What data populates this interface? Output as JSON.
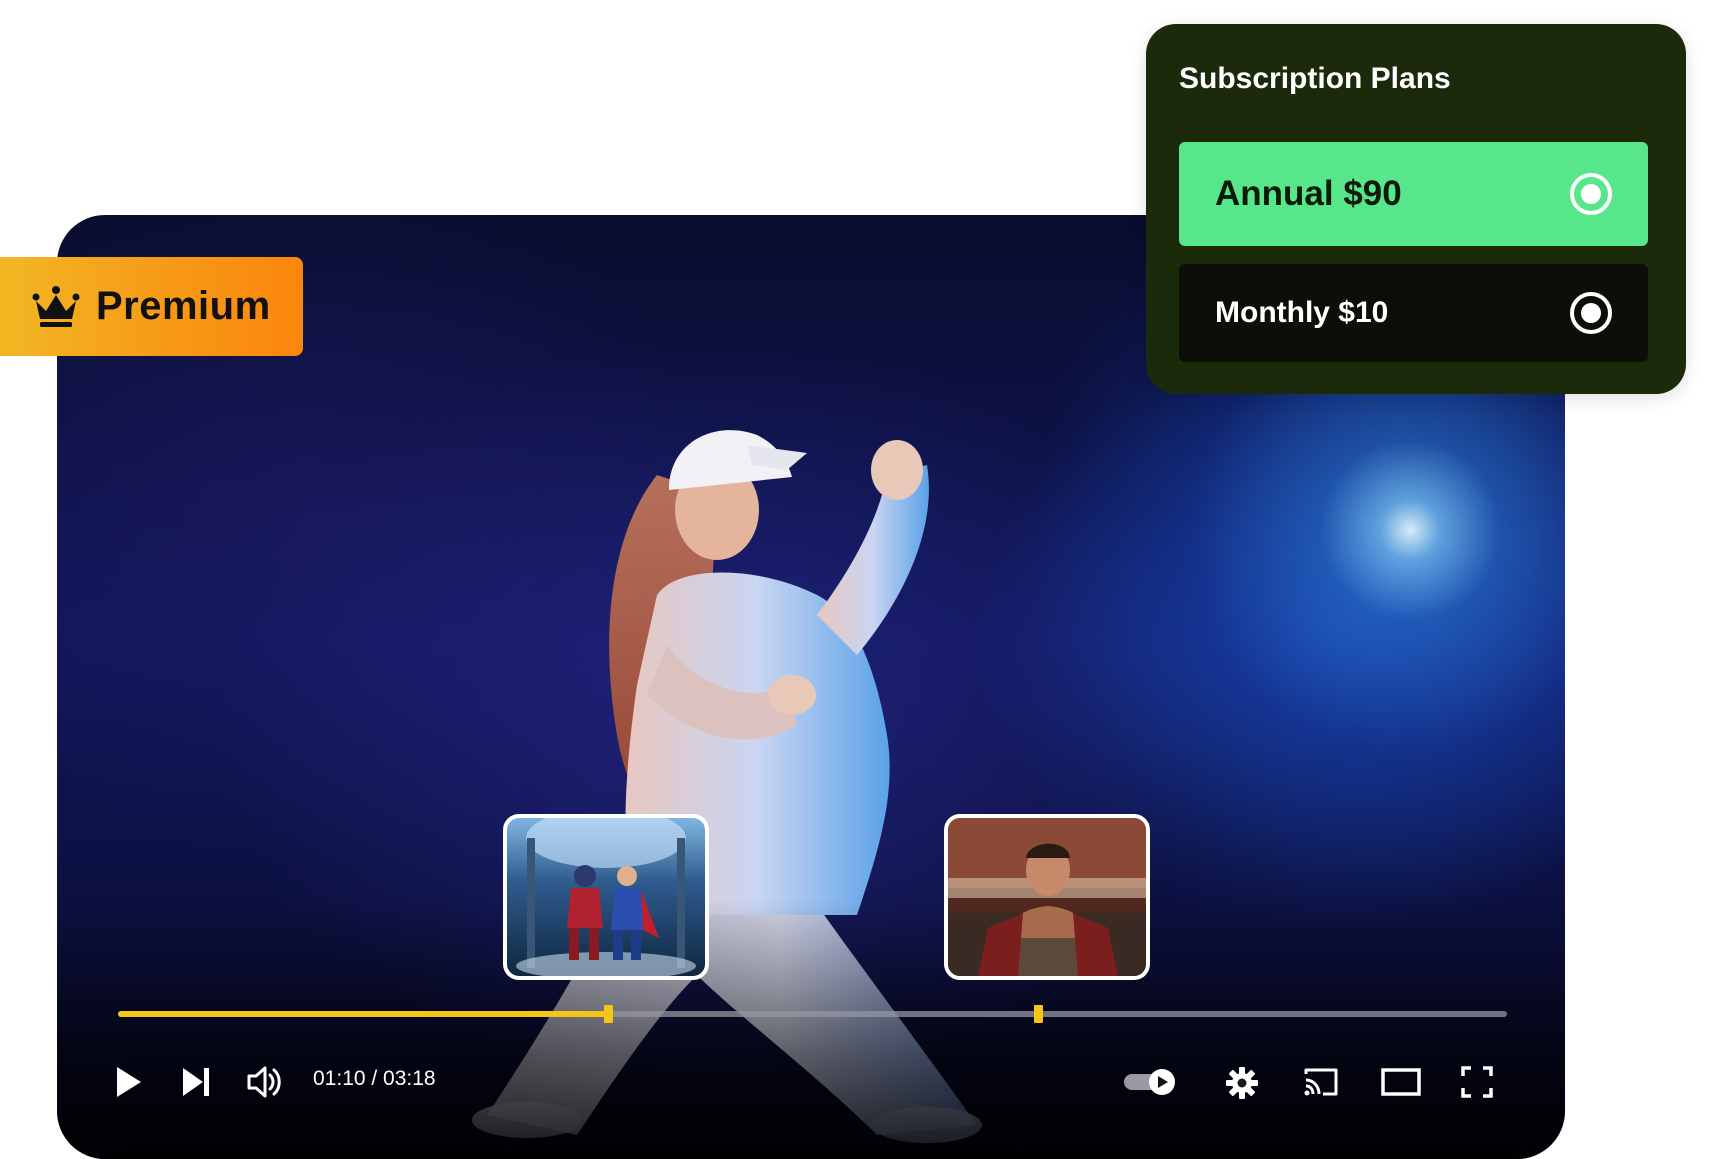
{
  "badge": {
    "label": "Premium",
    "icon": "crown-icon"
  },
  "subscription": {
    "title": "Subscription Plans",
    "plans": [
      {
        "label": "Annual $90",
        "selected": true,
        "background": "#57e68a"
      },
      {
        "label": "Monthly $10",
        "selected": false,
        "background": "#0c0f08"
      }
    ]
  },
  "player": {
    "time_display": "01:10 / 03:18",
    "progress_fraction": 0.353,
    "chapter_marker_fraction": 0.662,
    "accent_color": "#f5c518",
    "controls": [
      "play-icon",
      "skip-next-icon",
      "volume-icon",
      "autoplay-toggle",
      "settings-icon",
      "cast-icon",
      "theater-mode-icon",
      "fullscreen-icon"
    ]
  },
  "thumbnails": [
    {
      "icon": "superhero-duo-thumbnail"
    },
    {
      "icon": "gladiator-thumbnail"
    }
  ]
}
